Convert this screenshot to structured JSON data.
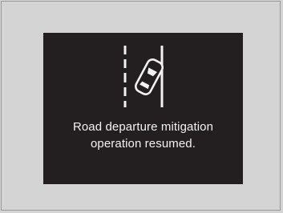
{
  "display": {
    "icon": "road-departure-car-icon",
    "message_line1": "Road departure mitigation",
    "message_line2": "operation resumed."
  }
}
